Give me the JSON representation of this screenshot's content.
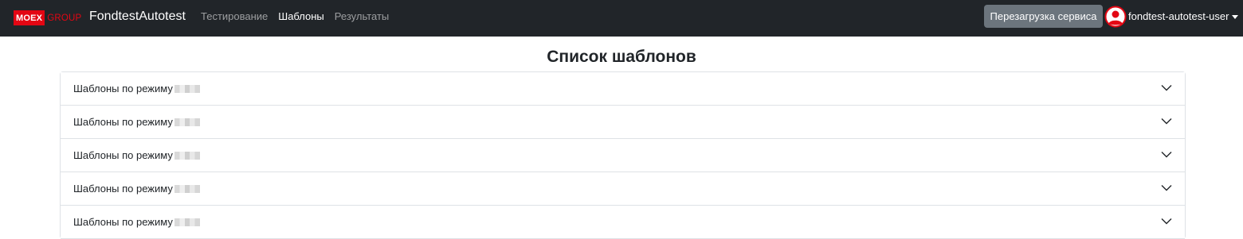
{
  "navbar": {
    "logo_main": "MOEX",
    "logo_sub": "GROUP",
    "brand": "FondtestAutotest",
    "links": [
      {
        "label": "Тестирование",
        "active": false
      },
      {
        "label": "Шаблоны",
        "active": true
      },
      {
        "label": "Результаты",
        "active": false
      }
    ],
    "reload_label": "Перезагрузка сервиса",
    "user_name": "fondtest-autotest-user",
    "user_icon": "user-circle-icon",
    "accent_color": "#e30613"
  },
  "main": {
    "title": "Список шаблонов",
    "items": [
      {
        "label": "Шаблоны по режиму",
        "expanded": false
      },
      {
        "label": "Шаблоны по режиму",
        "expanded": false
      },
      {
        "label": "Шаблоны по режиму",
        "expanded": false
      },
      {
        "label": "Шаблоны по режиму",
        "expanded": false
      },
      {
        "label": "Шаблоны по режиму",
        "expanded": false
      }
    ],
    "expand_icon": "chevron-down-icon"
  }
}
